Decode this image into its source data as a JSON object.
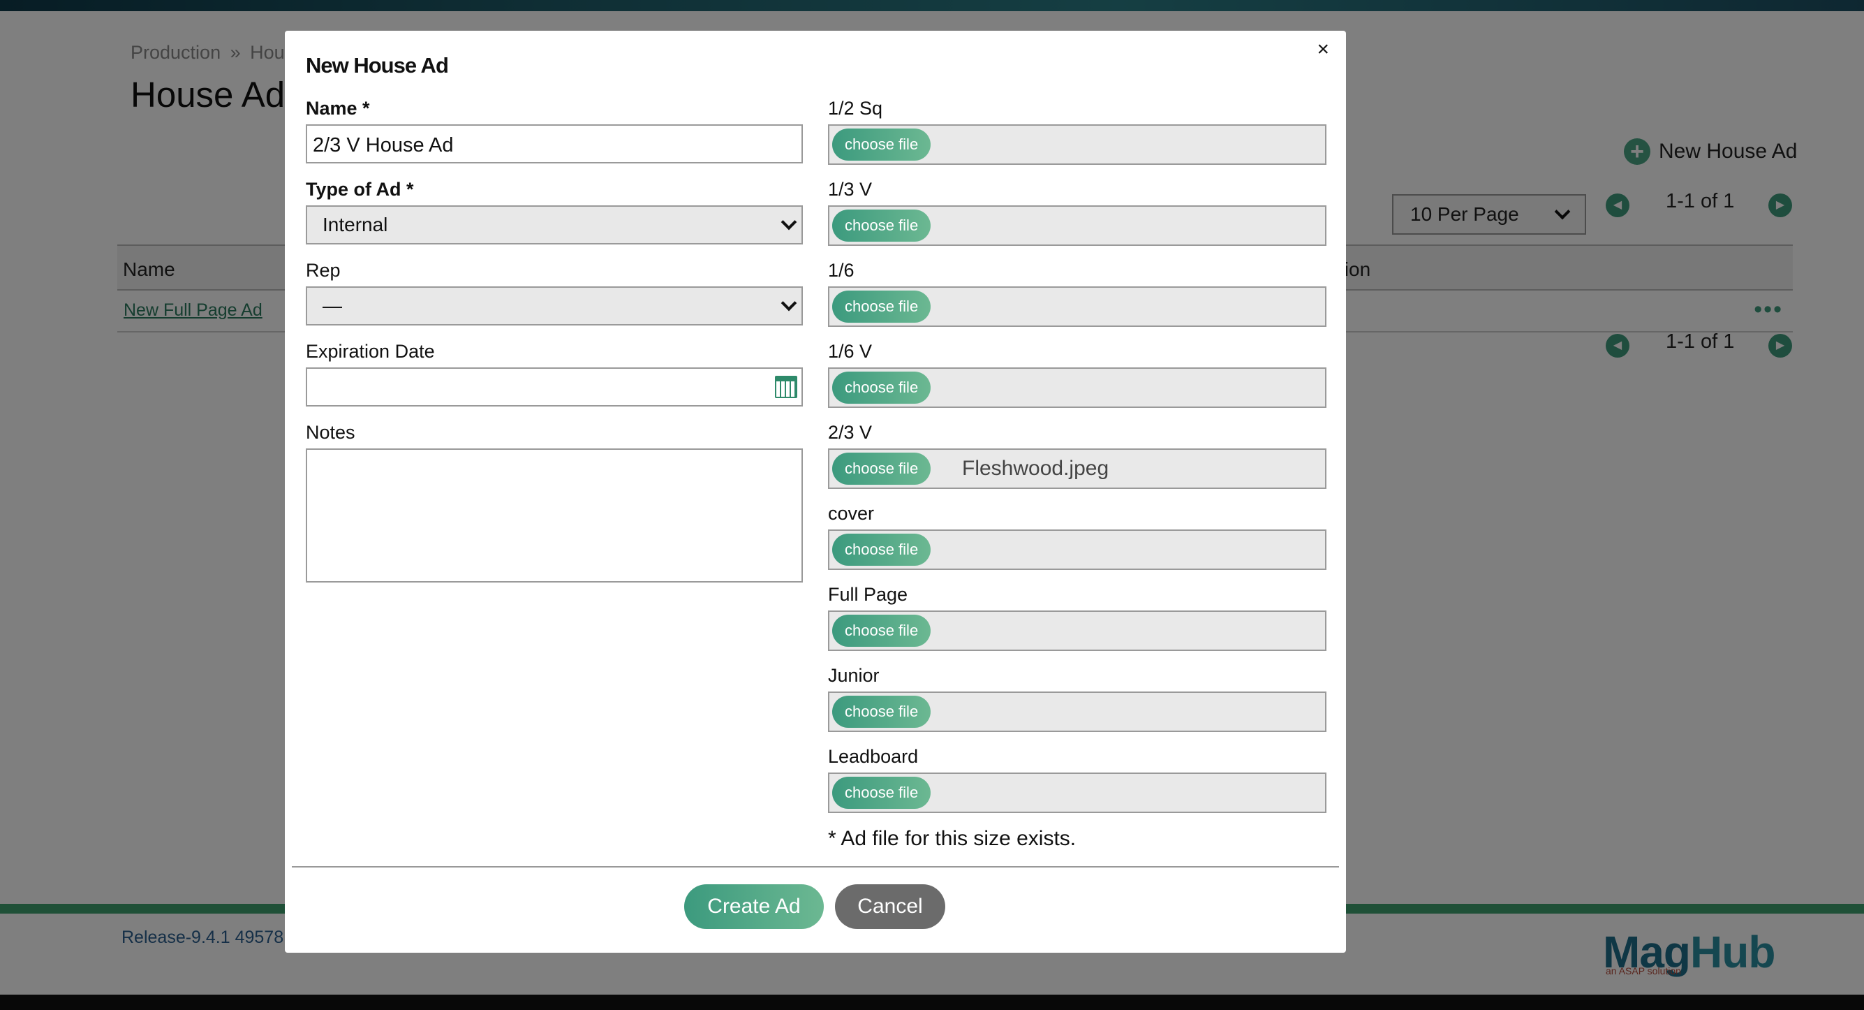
{
  "background": {
    "breadcrumb": [
      "Production",
      "»",
      "Hou"
    ],
    "page_title": "House Ads",
    "new_house_ad": "New House Ad",
    "per_page": "10 Per Page",
    "pagination": "1-1 of 1",
    "table": {
      "headers": [
        "Name",
        "tion"
      ],
      "rows": [
        {
          "name": "New Full Page Ad",
          "menu": "•••"
        }
      ]
    },
    "release": "Release-9.4.1 49578 |",
    "logo": {
      "mag": "Mag",
      "hub": "Hub",
      "tagline": "an ASAP solution"
    }
  },
  "modal": {
    "title": "New House Ad",
    "close": "×",
    "name_label": "Name *",
    "name_value": "2/3 V House Ad",
    "type_label": "Type of Ad *",
    "type_value": "Internal",
    "rep_label": "Rep",
    "rep_value": "—",
    "expiration_label": "Expiration Date",
    "expiration_value": "",
    "notes_label": "Notes",
    "notes_value": "",
    "choose_label": "choose file",
    "files": [
      {
        "label": "1/2 Sq",
        "file": ""
      },
      {
        "label": "1/3 V",
        "file": ""
      },
      {
        "label": "1/6",
        "file": ""
      },
      {
        "label": "1/6 V",
        "file": ""
      },
      {
        "label": "2/3 V",
        "file": "Fleshwood.jpeg"
      },
      {
        "label": "cover",
        "file": ""
      },
      {
        "label": "Full Page",
        "file": ""
      },
      {
        "label": "Junior",
        "file": ""
      },
      {
        "label": "Leadboard",
        "file": ""
      }
    ],
    "note": "* Ad file for this size exists.",
    "create_button": "Create Ad",
    "cancel_button": "Cancel"
  }
}
